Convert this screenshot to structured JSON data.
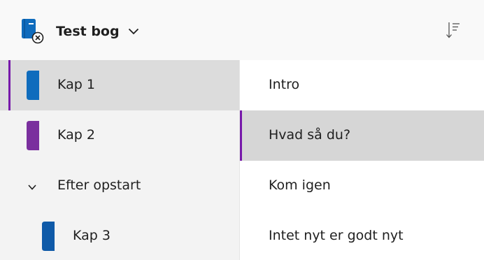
{
  "header": {
    "notebook_name": "Test bog",
    "notebook_icon": "notebook-icon",
    "chevron_icon": "chevron-down-icon",
    "sort_icon": "sort-icon"
  },
  "sections": [
    {
      "label": "Kap 1",
      "color": "#0f6cbd",
      "selected": true
    },
    {
      "label": "Kap 2",
      "color": "#7a2f9e",
      "selected": false
    }
  ],
  "section_group": {
    "label": "Efter opstart",
    "expanded": true,
    "sections": [
      {
        "label": "Kap 3",
        "color": "#0f5aa8",
        "selected": false
      }
    ]
  },
  "pages": [
    {
      "label": "Intro",
      "selected": false
    },
    {
      "label": "Hvad så du?",
      "selected": true
    },
    {
      "label": "Kom igen",
      "selected": false
    },
    {
      "label": "Intet nyt er godt nyt",
      "selected": false
    }
  ],
  "colors": {
    "accent": "#7719aa",
    "header_bg": "#f9f9f9",
    "sections_bg": "#f3f3f3",
    "selected_section_bg": "#dcdcdc",
    "selected_page_bg": "#d6d6d6"
  }
}
